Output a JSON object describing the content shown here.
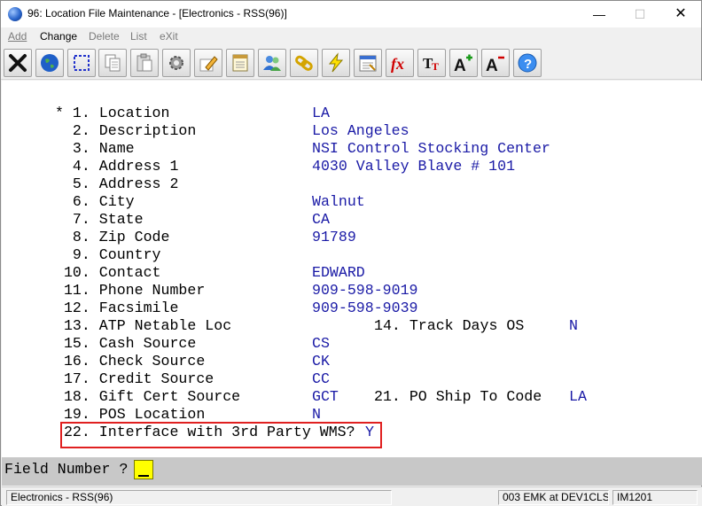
{
  "window": {
    "title": "96: Location File Maintenance - [Electronics - RSS(96)]",
    "controls": {
      "minimize": "—",
      "maximize": "☐",
      "close": "✕"
    }
  },
  "menu": {
    "add": "Add",
    "change": "Change",
    "delete": "Delete",
    "list": "List",
    "exit": "eXit",
    "active_item": "Change"
  },
  "toolbar": {
    "buttons": [
      "close-x-icon",
      "globe-icon",
      "select-rectangle-icon",
      "copy-icon",
      "paste-icon",
      "settings-gear-icon",
      "edit-pencil-icon",
      "notepad-icon",
      "users-icon",
      "link-chain-icon",
      "lightning-icon",
      "calendar-form-icon",
      "fx-function-icon",
      "text-style-icon",
      "font-increase-icon",
      "font-decrease-icon",
      "help-icon"
    ]
  },
  "form": {
    "fields": [
      {
        "label": "* 1. Location",
        "value": "LA"
      },
      {
        "label": "  2. Description",
        "value": "Los Angeles"
      },
      {
        "label": "  3. Name",
        "value": "NSI Control Stocking Center"
      },
      {
        "label": "  4. Address 1",
        "value": "4030 Valley Blave # 101"
      },
      {
        "label": "  5. Address 2",
        "value": ""
      },
      {
        "label": "  6. City",
        "value": "Walnut"
      },
      {
        "label": "  7. State",
        "value": "CA"
      },
      {
        "label": "  8. Zip Code",
        "value": "91789"
      },
      {
        "label": "  9. Country",
        "value": ""
      },
      {
        "label": " 10. Contact",
        "value": "EDWARD"
      },
      {
        "label": " 11. Phone Number",
        "value": "909-598-9019"
      },
      {
        "label": " 12. Facsimile",
        "value": "909-598-9039"
      },
      {
        "label": " 13. ATP Netable Loc",
        "value": ""
      },
      {
        "label": " 15. Cash Source",
        "value": "CS"
      },
      {
        "label": " 16. Check Source",
        "value": "CK"
      },
      {
        "label": " 17. Credit Source",
        "value": "CC"
      },
      {
        "label": " 18. Gift Cert Source",
        "value": "GCT"
      },
      {
        "label": " 19. POS Location",
        "value": "N"
      }
    ],
    "track_days": {
      "label": "14. Track Days OS",
      "value": "N"
    },
    "po_ship_to": {
      "label": "21. PO Ship To Code",
      "value": "LA"
    },
    "interface": {
      "label": " 22. Interface with 3rd Party WMS?",
      "value": "Y"
    }
  },
  "prompt": {
    "label": "Field Number ?",
    "value": ""
  },
  "status": {
    "company": "Electronics - RSS(96)",
    "session": "003 EMK at DEV1CLS",
    "program": "IM1201"
  },
  "colors": {
    "value_text": "#1a1aa6",
    "highlight_border": "#e02020",
    "cursor_bg": "#ffff00",
    "prompt_bg": "#c8c8c8"
  }
}
